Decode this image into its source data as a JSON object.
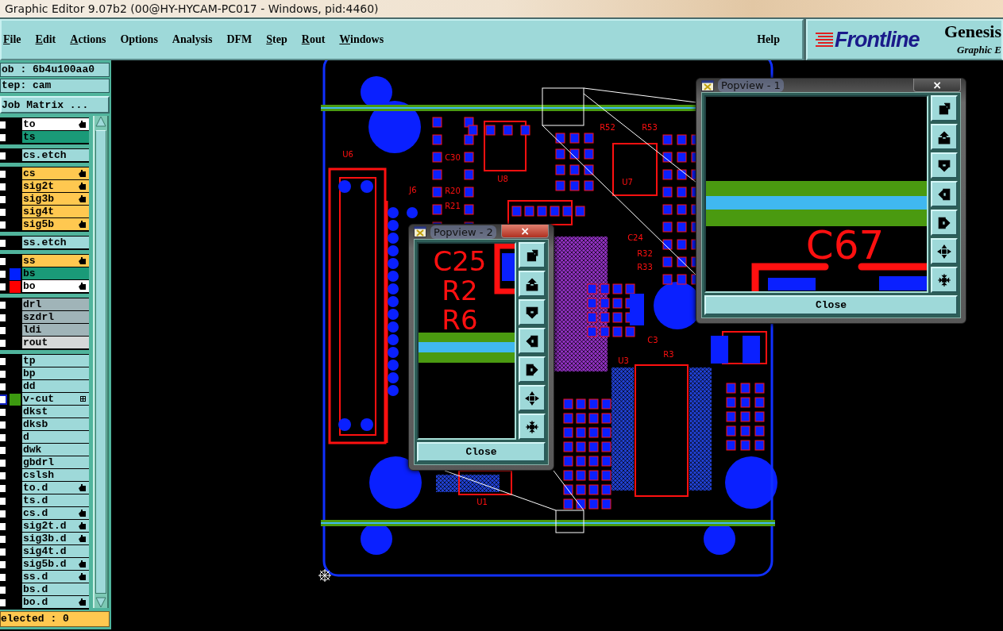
{
  "window": {
    "title": "Graphic Editor 9.07b2 (00@HY-HYCAM-PC017 - Windows, pid:4460)"
  },
  "menu": {
    "items": [
      {
        "label": "File",
        "mnemonic": true
      },
      {
        "label": "Edit",
        "mnemonic": true
      },
      {
        "label": "Actions",
        "mnemonic": true
      },
      {
        "label": "Options",
        "mnemonic": false
      },
      {
        "label": "Analysis",
        "mnemonic": false
      },
      {
        "label": "DFM",
        "mnemonic": false
      },
      {
        "label": "Step",
        "mnemonic": true
      },
      {
        "label": "Rout",
        "mnemonic": true
      },
      {
        "label": "Windows",
        "mnemonic": true
      }
    ],
    "help": "Help"
  },
  "logo": {
    "brand": "Frontline",
    "product": "Genesis",
    "subtitle": "Graphic E"
  },
  "job_panel": {
    "job": "ob : 6b4u100aa0",
    "step": "tep: cam",
    "matrix_button": "Job Matrix ..."
  },
  "layer_groups": [
    {
      "layers": [
        {
          "name": "to",
          "kind": "silk_screen",
          "checked": false,
          "affected": true,
          "work_layer": false
        },
        {
          "name": "ts",
          "kind": "solder_mask",
          "checked": false,
          "affected": false,
          "work_layer": false
        }
      ]
    },
    {
      "layers": [
        {
          "name": "cs.etch",
          "kind": "document",
          "checked": false,
          "affected": false,
          "work_layer": false
        }
      ]
    },
    {
      "layers": [
        {
          "name": "cs",
          "kind": "signal",
          "checked": false,
          "affected": true,
          "work_layer": false
        },
        {
          "name": "sig2t",
          "kind": "signal",
          "checked": false,
          "affected": true,
          "work_layer": false
        },
        {
          "name": "sig3b",
          "kind": "signal",
          "checked": false,
          "affected": true,
          "work_layer": false
        },
        {
          "name": "sig4t",
          "kind": "signal",
          "checked": false,
          "affected": false,
          "work_layer": false
        },
        {
          "name": "sig5b",
          "kind": "signal",
          "checked": false,
          "affected": true,
          "work_layer": false
        }
      ]
    },
    {
      "layers": [
        {
          "name": "ss.etch",
          "kind": "document",
          "checked": false,
          "affected": false,
          "work_layer": false
        }
      ]
    },
    {
      "layers": [
        {
          "name": "ss",
          "kind": "signal",
          "checked": false,
          "affected": true,
          "work_layer": false
        },
        {
          "name": "bs",
          "kind": "solder_mask",
          "color": "#0020ff",
          "checked": false,
          "affected": false,
          "work_layer": false
        },
        {
          "name": "bo",
          "kind": "silk_screen",
          "color": "#ff0000",
          "checked": false,
          "affected": true,
          "work_layer": false
        }
      ]
    },
    {
      "layers": [
        {
          "name": "drl",
          "kind": "drill",
          "checked": false,
          "affected": false,
          "work_layer": false
        },
        {
          "name": "szdrl",
          "kind": "drill",
          "checked": false,
          "affected": false,
          "work_layer": false
        },
        {
          "name": "ldi",
          "kind": "drill",
          "checked": false,
          "affected": false,
          "work_layer": false
        },
        {
          "name": "rout",
          "kind": "rout",
          "checked": false,
          "affected": false,
          "work_layer": false
        }
      ]
    },
    {
      "layers": [
        {
          "name": "tp",
          "kind": "document",
          "checked": false,
          "affected": false,
          "work_layer": false
        },
        {
          "name": "bp",
          "kind": "document",
          "checked": false,
          "affected": false,
          "work_layer": false
        },
        {
          "name": "dd",
          "kind": "document",
          "checked": false,
          "affected": false,
          "work_layer": false
        },
        {
          "name": "v-cut",
          "kind": "document",
          "color": "#3c9a10",
          "checked": false,
          "affected": false,
          "work_layer": true
        },
        {
          "name": "dkst",
          "kind": "document",
          "checked": false,
          "affected": false,
          "work_layer": false
        },
        {
          "name": "dksb",
          "kind": "document",
          "checked": false,
          "affected": false,
          "work_layer": false
        },
        {
          "name": "d",
          "kind": "document",
          "checked": false,
          "affected": false,
          "work_layer": false
        },
        {
          "name": "dwk",
          "kind": "document",
          "checked": false,
          "affected": false,
          "work_layer": false
        },
        {
          "name": "gbdrl",
          "kind": "document",
          "checked": false,
          "affected": false,
          "work_layer": false
        },
        {
          "name": "cslsh",
          "kind": "document",
          "checked": false,
          "affected": false,
          "work_layer": false
        },
        {
          "name": "to.d",
          "kind": "document",
          "checked": false,
          "affected": true,
          "work_layer": false
        },
        {
          "name": "ts.d",
          "kind": "document",
          "checked": false,
          "affected": false,
          "work_layer": false
        },
        {
          "name": "cs.d",
          "kind": "document",
          "checked": false,
          "affected": true,
          "work_layer": false
        },
        {
          "name": "sig2t.d",
          "kind": "document",
          "checked": false,
          "affected": true,
          "work_layer": false
        },
        {
          "name": "sig3b.d",
          "kind": "document",
          "checked": false,
          "affected": true,
          "work_layer": false
        },
        {
          "name": "sig4t.d",
          "kind": "document",
          "checked": false,
          "affected": false,
          "work_layer": false
        },
        {
          "name": "sig5b.d",
          "kind": "document",
          "checked": false,
          "affected": true,
          "work_layer": false
        },
        {
          "name": "ss.d",
          "kind": "document",
          "checked": false,
          "affected": true,
          "work_layer": false
        },
        {
          "name": "bs.d",
          "kind": "document",
          "checked": false,
          "affected": false,
          "work_layer": false
        },
        {
          "name": "bo.d",
          "kind": "document",
          "checked": false,
          "affected": true,
          "work_layer": false
        }
      ]
    }
  ],
  "status": "elected : 0",
  "board": {
    "labels": [
      "U6",
      "J6",
      "C30",
      "R20",
      "R21",
      "U8",
      "R52",
      "R53",
      "U7",
      "C24",
      "R32",
      "R33",
      "C3",
      "R3",
      "U3",
      "U1"
    ]
  },
  "popviews": [
    {
      "title": "Popview - 1",
      "close_glyph": "×",
      "labels": [
        "C67"
      ],
      "close_button": "Close"
    },
    {
      "title": "Popview - 2",
      "close_glyph": "×",
      "labels": [
        "C25",
        "R2",
        "R6"
      ],
      "close_button": "Close"
    }
  ]
}
